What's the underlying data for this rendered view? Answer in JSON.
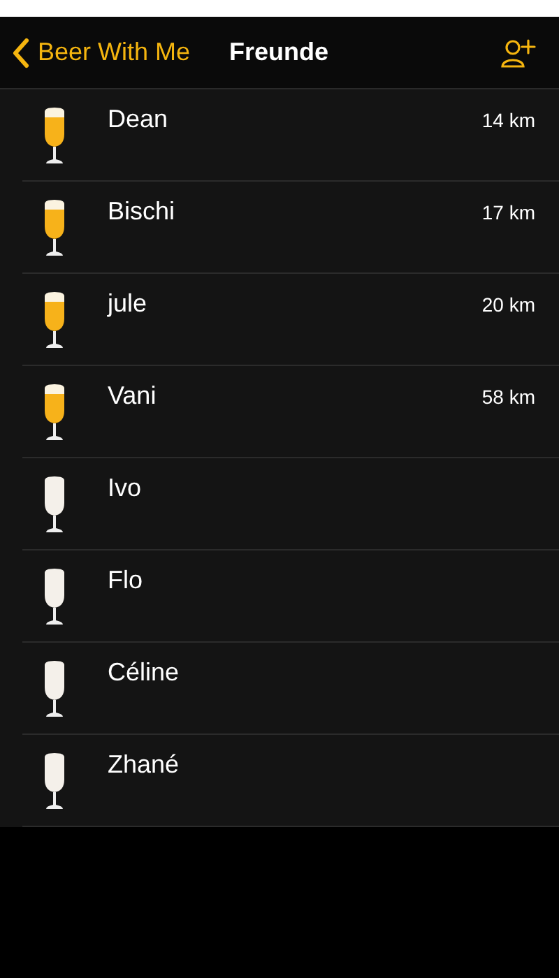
{
  "nav": {
    "back": "Beer With Me",
    "title": "Freunde"
  },
  "friends": [
    {
      "name": "Dean",
      "filled": true,
      "distance": "14 km"
    },
    {
      "name": "Bischi",
      "filled": true,
      "distance": "17 km"
    },
    {
      "name": "jule",
      "filled": true,
      "distance": "20 km"
    },
    {
      "name": "Vani",
      "filled": true,
      "distance": "58 km"
    },
    {
      "name": "Ivo",
      "filled": false
    },
    {
      "name": "Flo",
      "filled": false
    },
    {
      "name": "Céline",
      "filled": false
    },
    {
      "name": "Zhané",
      "filled": false
    }
  ]
}
